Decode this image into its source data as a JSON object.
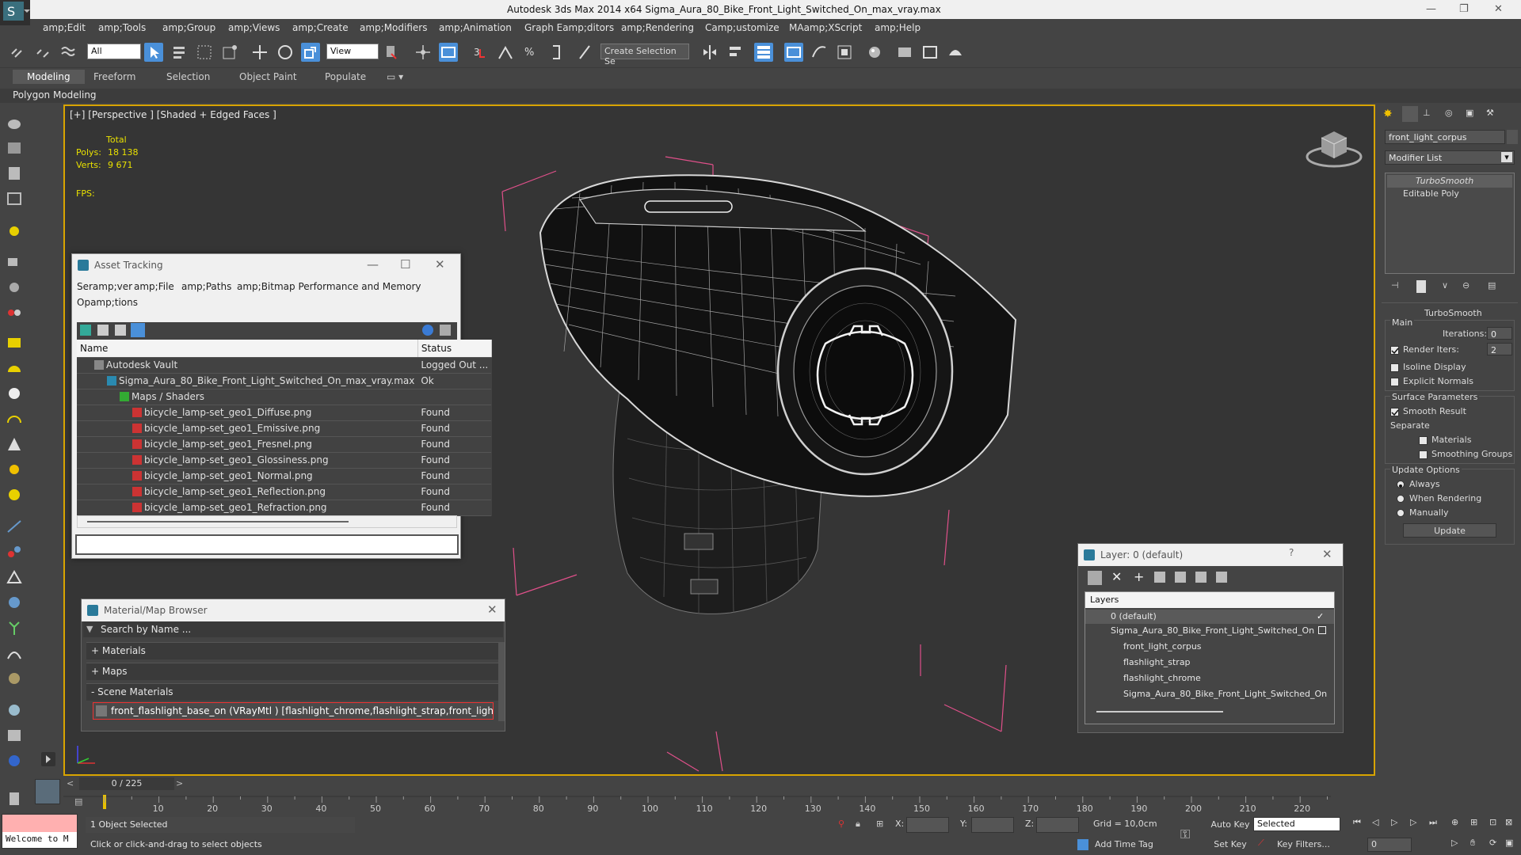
{
  "window": {
    "title": "Autodesk 3ds Max  2014 x64     Sigma_Aura_80_Bike_Front_Light_Switched_On_max_vray.max",
    "minimize": "—",
    "maximize": "❐",
    "close": "✕"
  },
  "menu": [
    "amp;Edit",
    "amp;Tools",
    "amp;Group",
    "amp;Views",
    "amp;Create",
    "amp;Modifiers",
    "amp;Animation",
    "Graph Eamp;ditors",
    "amp;Rendering",
    "Camp;ustomize",
    "MAamp;XScript",
    "amp;Help"
  ],
  "toolbar": {
    "filter_select": "All",
    "refcoord_select": "View",
    "selection_set": "Create Selection Se"
  },
  "ribbon": {
    "tabs": [
      "Modeling",
      "Freeform",
      "Selection",
      "Object Paint",
      "Populate"
    ],
    "active": "Modeling",
    "sub": "Polygon Modeling"
  },
  "viewport": {
    "label": "[+] [Perspective ] [Shaded + Edged Faces ]",
    "stats": {
      "total": "Total",
      "polys_label": "Polys:",
      "polys": "18 138",
      "verts_label": "Verts:",
      "verts": "9 671",
      "fps_label": "FPS:"
    }
  },
  "asset_tracking": {
    "title": "Asset Tracking",
    "menu_row1": [
      "Seramp;ver",
      "amp;File",
      "amp;Paths",
      "amp;Bitmap Performance and Memory"
    ],
    "menu_row2": "Opamp;tions",
    "columns": [
      "Name",
      "Status"
    ],
    "rows": [
      {
        "name": "Autodesk Vault",
        "status": "Logged Out ...",
        "indent": 1,
        "icon": "vault"
      },
      {
        "name": "Sigma_Aura_80_Bike_Front_Light_Switched_On_max_vray.max",
        "status": "Ok",
        "indent": 2,
        "icon": "max"
      },
      {
        "name": "Maps / Shaders",
        "status": "",
        "indent": 3,
        "icon": "maps"
      },
      {
        "name": "bicycle_lamp-set_geo1_Diffuse.png",
        "status": "Found",
        "indent": 4,
        "icon": "png"
      },
      {
        "name": "bicycle_lamp-set_geo1_Emissive.png",
        "status": "Found",
        "indent": 4,
        "icon": "png"
      },
      {
        "name": "bicycle_lamp-set_geo1_Fresnel.png",
        "status": "Found",
        "indent": 4,
        "icon": "png"
      },
      {
        "name": "bicycle_lamp-set_geo1_Glossiness.png",
        "status": "Found",
        "indent": 4,
        "icon": "png"
      },
      {
        "name": "bicycle_lamp-set_geo1_Normal.png",
        "status": "Found",
        "indent": 4,
        "icon": "png"
      },
      {
        "name": "bicycle_lamp-set_geo1_Reflection.png",
        "status": "Found",
        "indent": 4,
        "icon": "png"
      },
      {
        "name": "bicycle_lamp-set_geo1_Refraction.png",
        "status": "Found",
        "indent": 4,
        "icon": "png"
      }
    ]
  },
  "material_browser": {
    "title": "Material/Map Browser",
    "search_placeholder": "Search by Name ...",
    "sections": [
      "+ Materials",
      "+ Maps",
      "- Scene Materials"
    ],
    "scene_material": "front_flashlight_base_on (VRayMtl ) [flashlight_chrome,flashlight_strap,front_light_corpus]"
  },
  "layer_panel": {
    "title": "Layer: 0 (default)",
    "help": "?",
    "header": "Layers",
    "items": [
      {
        "name": "0 (default)",
        "indent": 0
      },
      {
        "name": "Sigma_Aura_80_Bike_Front_Light_Switched_On",
        "indent": 0
      },
      {
        "name": "front_light_corpus",
        "indent": 1
      },
      {
        "name": "flashlight_strap",
        "indent": 1
      },
      {
        "name": "flashlight_chrome",
        "indent": 1
      },
      {
        "name": "Sigma_Aura_80_Bike_Front_Light_Switched_On",
        "indent": 1
      }
    ]
  },
  "command_panel": {
    "object_name": "front_light_corpus",
    "modifier_list": "Modifier List",
    "stack": [
      "TurboSmooth",
      "Editable Poly"
    ],
    "rollout": "TurboSmooth",
    "main": "Main",
    "iterations_label": "Iterations:",
    "iterations": "0",
    "render_iters_label": "Render Iters:",
    "render_iters": "2",
    "isoline": "Isoline Display",
    "explicit_normals": "Explicit Normals",
    "surface_params": "Surface Parameters",
    "smooth_result": "Smooth Result",
    "separate": "Separate",
    "materials": "Materials",
    "smoothing_groups": "Smoothing Groups",
    "update_options": "Update Options",
    "always": "Always",
    "when_rendering": "When Rendering",
    "manually": "Manually",
    "update_button": "Update"
  },
  "timeline": {
    "frame": "0 / 225",
    "ticks": [
      "10",
      "20",
      "30",
      "40",
      "50",
      "60",
      "70",
      "80",
      "90",
      "100",
      "110",
      "120",
      "130",
      "140",
      "150",
      "160",
      "170",
      "180",
      "190",
      "200",
      "210",
      "220"
    ]
  },
  "status": {
    "welcome": "Welcome to M",
    "selection": "1 Object Selected",
    "prompt": "Click or click-and-drag to select objects",
    "x": "X:",
    "y": "Y:",
    "z": "Z:",
    "grid": "Grid = 10,0cm",
    "add_time_tag": "Add Time Tag",
    "auto_key": "Auto Key",
    "set_key": "Set Key",
    "key_mode": "Selected",
    "key_filters": "Key Filters...",
    "frame_field": "0"
  }
}
